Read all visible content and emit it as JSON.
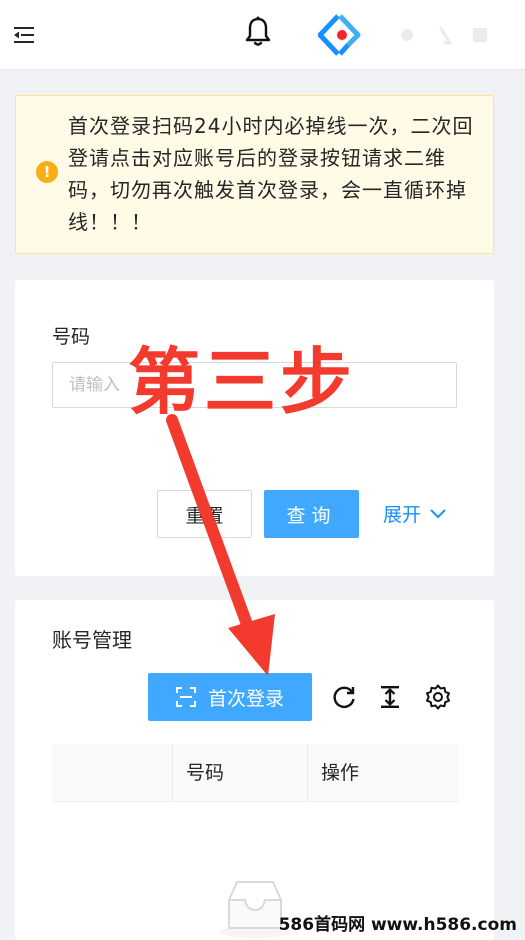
{
  "header": {
    "menu_icon": "menu-fold-icon",
    "bell_icon": "bell-icon",
    "logo": "app-logo"
  },
  "alert": {
    "icon": "exclamation-circle-icon",
    "text": "首次登录扫码24小时内必掉线一次，二次回登请点击对应账号后的登录按钮请求二维码，切勿再次触发首次登录，会一直循环掉线！！！"
  },
  "search_form": {
    "label": "号码",
    "placeholder": "请输入",
    "reset_label": "重置",
    "query_label": "查询",
    "expand_label": "展开"
  },
  "account_table": {
    "title": "账号管理",
    "first_login_label": "首次登录",
    "tools": [
      "reload-icon",
      "column-height-icon",
      "setting-icon"
    ],
    "columns": [
      "",
      "号码",
      "操作"
    ]
  },
  "overlay": {
    "step_text": "第三步",
    "color": "#f23b2e"
  },
  "watermark": {
    "text": "586首码网 www.h586.com"
  },
  "colors": {
    "primary": "#40a9ff",
    "link": "#1890ff",
    "warning_bg": "#fffbe6",
    "warning_border": "#ffe58f",
    "warning_icon": "#faad14"
  }
}
